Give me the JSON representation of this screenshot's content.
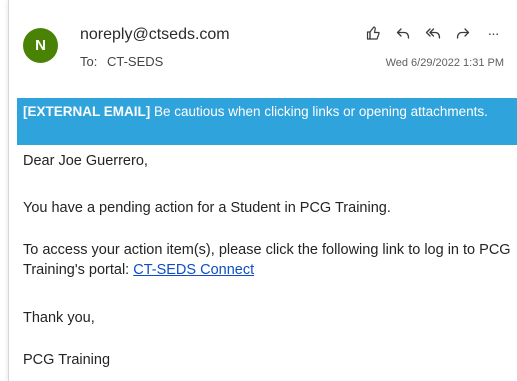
{
  "email": {
    "avatar_initial": "N",
    "from": "noreply@ctseds.com",
    "to_label": "To:",
    "to": "CT-SEDS",
    "date": "Wed 6/29/2022 1:31 PM"
  },
  "toolbar": {
    "like_icon": "thumbs-up-icon",
    "reply_icon": "reply-icon",
    "reply_all_icon": "reply-all-icon",
    "forward_icon": "forward-icon",
    "more_label": "···"
  },
  "banner": {
    "tag": "[EXTERNAL EMAIL]",
    "text": " Be cautious when clicking links or opening attachments."
  },
  "body": {
    "greeting": "Dear Joe Guerrero,",
    "line1": "You have a pending action for a Student in PCG Training.",
    "line2": "To access your action item(s), please click the following link to log in to PCG Training's portal: ",
    "link": "CT-SEDS Connect",
    "closing": "Thank you,",
    "signature": "PCG Training"
  },
  "colors": {
    "avatar": "#498205",
    "banner": "#2ea3dc",
    "link": "#0f4cc7"
  }
}
